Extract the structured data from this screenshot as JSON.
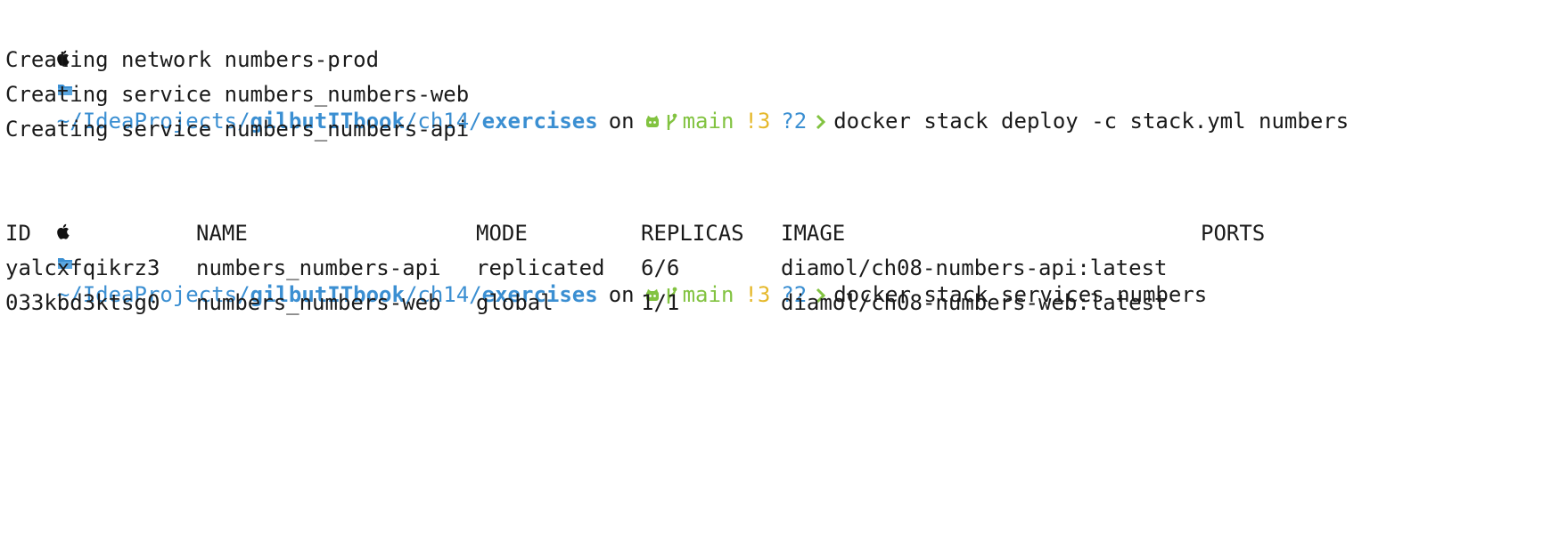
{
  "colors": {
    "path": "#3b8fd2",
    "branch": "#82c341",
    "modified": "#e5b82a",
    "untracked": "#3b8fd2",
    "chevron": "#82c341",
    "text": "#1a1a1a"
  },
  "prompt": {
    "path_prefix": "~/IdeaProjects/",
    "path_bold_1": "gilbutITbook",
    "path_mid": "/ch14/",
    "path_bold_2": "exercises",
    "on": "on",
    "branch": "main",
    "modified": "!3",
    "untracked": "?2"
  },
  "icons": [
    "apple-icon",
    "folder-icon",
    "github-icon",
    "branch-icon",
    "chevron-right-icon"
  ],
  "commands": [
    "docker stack deploy -c stack.yml numbers",
    "docker stack services numbers"
  ],
  "deploy_output": [
    "Creating network numbers-prod",
    "Creating service numbers_numbers-web",
    "Creating service numbers_numbers-api"
  ],
  "services_table": {
    "headers": {
      "id": "ID",
      "name": "NAME",
      "mode": "MODE",
      "replicas": "REPLICAS",
      "image": "IMAGE",
      "ports": "PORTS"
    },
    "rows": [
      {
        "id": "yalcxfqikrz3",
        "name": "numbers_numbers-api",
        "mode": "replicated",
        "replicas": "6/6",
        "image": "diamol/ch08-numbers-api:latest",
        "ports": ""
      },
      {
        "id": "033kbd3ktsg0",
        "name": "numbers_numbers-web",
        "mode": "global",
        "replicas": "1/1",
        "image": "diamol/ch08-numbers-web:latest",
        "ports": ""
      }
    ]
  }
}
